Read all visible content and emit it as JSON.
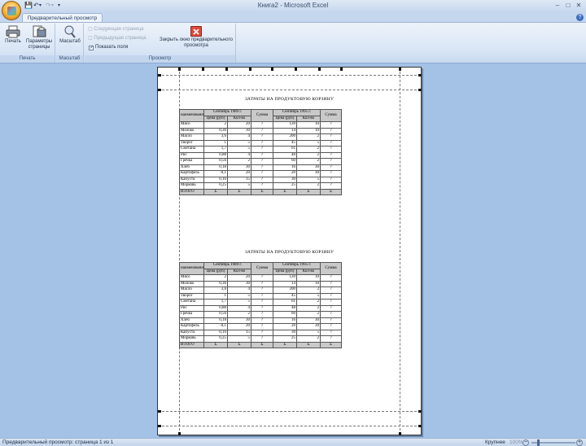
{
  "window": {
    "title": "Книга2 - Microsoft Excel"
  },
  "qat": {
    "save_icon": "save-icon",
    "undo_icon": "undo-icon",
    "redo_icon": "redo-icon",
    "customize_icon": "chevron-down-icon"
  },
  "tabs": [
    {
      "label": "Предварительный просмотр"
    }
  ],
  "ribbon": {
    "groups": {
      "print": {
        "label": "Печать",
        "print_label": "Печать",
        "page_setup_label": "Параметры страницы"
      },
      "zoom": {
        "label": "Масштаб",
        "zoom_label": "Масштаб"
      },
      "preview": {
        "label": "Просмотр",
        "next_page": "Следующая страница",
        "prev_page": "Предыдущая страница",
        "show_margins": "Показать поля",
        "show_margins_checked": true,
        "close_label": "Закрыть окно предварительного просмотра"
      }
    }
  },
  "sheet": {
    "title": "ЗАТРАТЫ НА ПРОДУКТОВУЮ КОРЗИНУ",
    "headers": {
      "name": "наименование",
      "period1": "Сентябрь 1989 г.",
      "period2": "Сентябрь 1995 г.",
      "price": "Цена (руб)",
      "qty": "Кол-во",
      "sum": "Сумма"
    },
    "rows": [
      [
        "Мясо",
        "2",
        "20",
        "?",
        "120",
        "10",
        "?"
      ],
      [
        "Молоко",
        "0,36",
        "30",
        "?",
        "14",
        "10",
        "?"
      ],
      [
        "Масло",
        "3,6",
        "4",
        "?",
        "200",
        "2",
        "?"
      ],
      [
        "Творог",
        "1",
        "5",
        "?",
        "45",
        "5",
        "?"
      ],
      [
        "Сметана",
        "1,7",
        "5",
        "?",
        "61",
        "2",
        "?"
      ],
      [
        "Рис",
        "0,88",
        "4",
        "?",
        "48",
        "2",
        "?"
      ],
      [
        "Гречка",
        "0,56",
        "2",
        "?",
        "60",
        "2",
        "?"
      ],
      [
        "Хлеб",
        "0,18",
        "30",
        "?",
        "16",
        "30",
        "?"
      ],
      [
        "Картофель",
        "-0,1",
        "20",
        "?",
        "20",
        "30",
        "?"
      ],
      [
        "Капуста",
        "0,16",
        "15",
        "?",
        "30",
        "5",
        "?"
      ],
      [
        "Морковь",
        "0,25",
        "5",
        "?",
        "25",
        "2",
        "?"
      ]
    ],
    "total": [
      "ИТОГО",
      "Σ",
      "Σ",
      "Σ",
      "Σ",
      "Σ",
      "Σ"
    ]
  },
  "status": {
    "text": "Предварительный просмотр: страница 1 из 1",
    "zoom_label": "Крупнее",
    "zoom_pct": "100%"
  }
}
